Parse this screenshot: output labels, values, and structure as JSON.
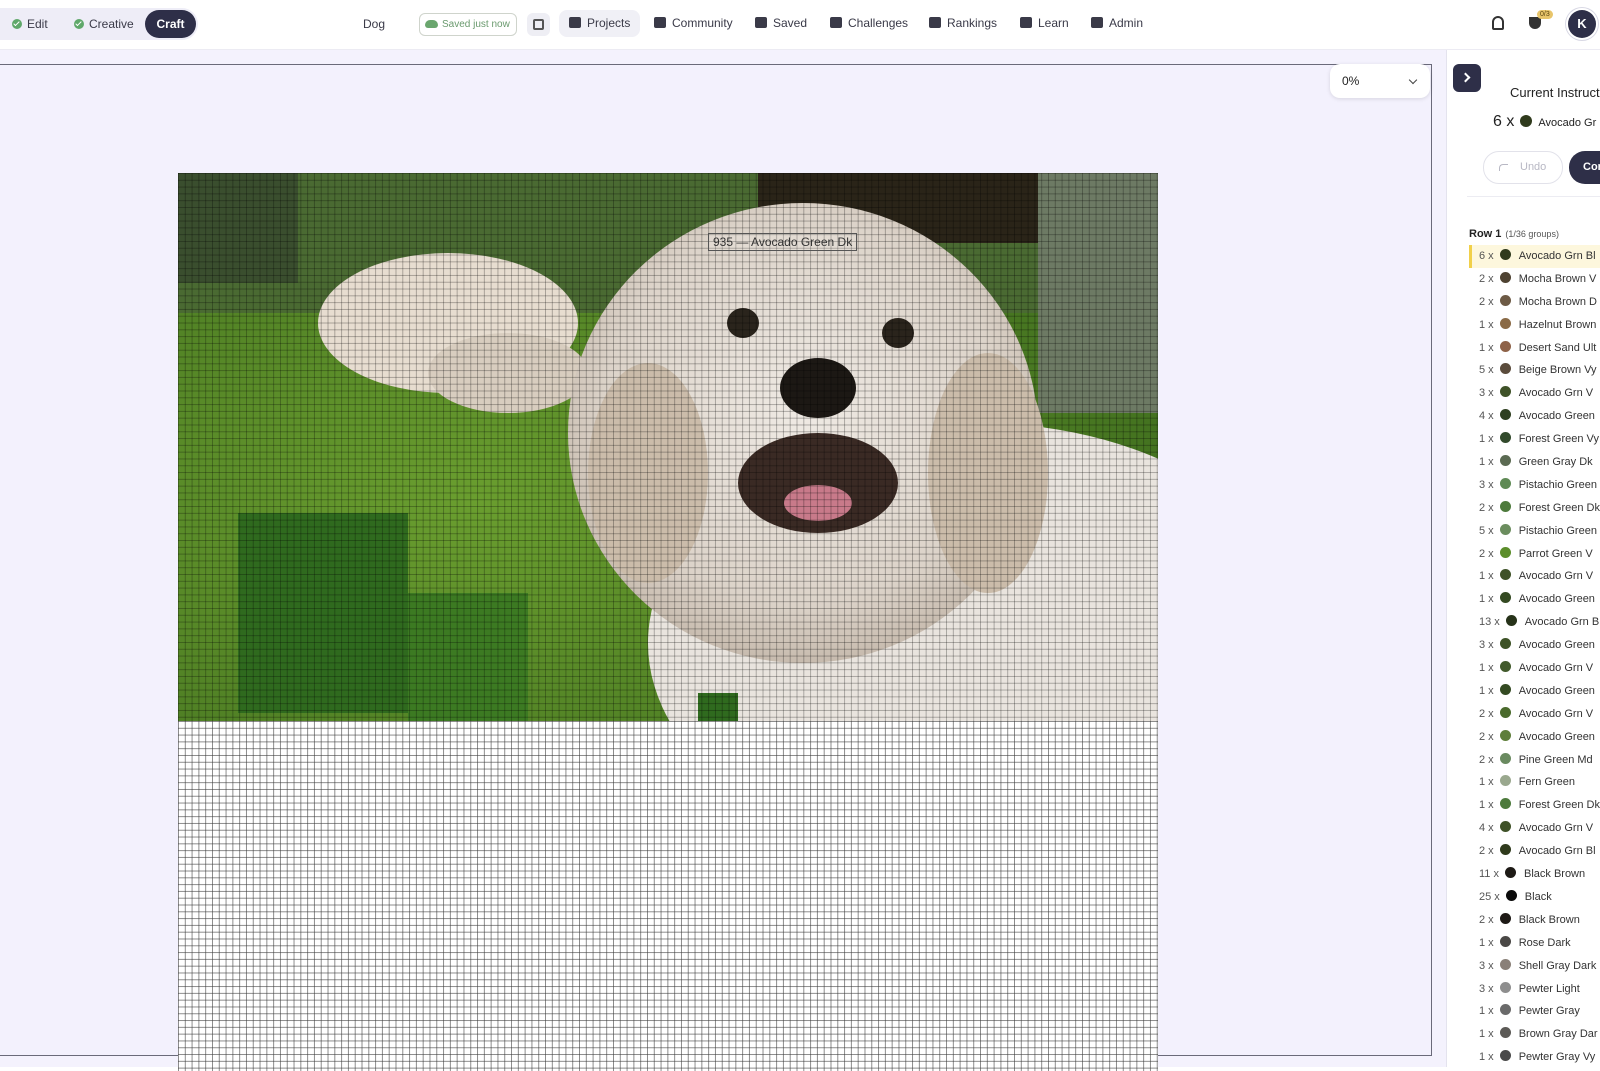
{
  "header": {
    "modes": [
      {
        "label": "Edit",
        "done": true
      },
      {
        "label": "Creative",
        "done": true
      },
      {
        "label": "Craft",
        "active": true
      }
    ],
    "project_name": "Dog",
    "saved_status": "Saved just now",
    "nav": [
      "Projects",
      "Community",
      "Saved",
      "Challenges",
      "Rankings",
      "Learn",
      "Admin"
    ],
    "active_nav": "Projects",
    "trophy_badge": "0/3",
    "avatar_initial": "K"
  },
  "canvas": {
    "zoom": "0%",
    "tooltip": "935 — Avocado Green Dk",
    "stitched_rows_fraction": 0.61
  },
  "panel": {
    "current_title": "Current Instruct",
    "current_count": "6 x",
    "current_color": "#2f3a1c",
    "current_name": "Avocado Gr",
    "undo_label": "Undo",
    "complete_label": "Cor",
    "row_label": "Row 1",
    "row_groups": "(1/36 groups)",
    "groups": [
      {
        "count": "6 x",
        "name": "Avocado Grn Bl",
        "color": "#2f3a1c",
        "active": true
      },
      {
        "count": "2 x",
        "name": "Mocha Brown V",
        "color": "#4e4231"
      },
      {
        "count": "2 x",
        "name": "Mocha Brown D",
        "color": "#6d5a45"
      },
      {
        "count": "1 x",
        "name": "Hazelnut Brown",
        "color": "#8a6a46"
      },
      {
        "count": "1 x",
        "name": "Desert Sand Ult",
        "color": "#8e6248"
      },
      {
        "count": "5 x",
        "name": "Beige Brown Vy",
        "color": "#5b4c3c"
      },
      {
        "count": "3 x",
        "name": "Avocado Grn V",
        "color": "#3f5228"
      },
      {
        "count": "4 x",
        "name": "Avocado Green",
        "color": "#2f4020"
      },
      {
        "count": "1 x",
        "name": "Forest Green Vy",
        "color": "#324a2c"
      },
      {
        "count": "1 x",
        "name": "Green Gray Dk",
        "color": "#5b6a52"
      },
      {
        "count": "3 x",
        "name": "Pistachio Green",
        "color": "#5f8a55"
      },
      {
        "count": "2 x",
        "name": "Forest Green Dk",
        "color": "#4d7a3c"
      },
      {
        "count": "5 x",
        "name": "Pistachio Green",
        "color": "#6b8d5e"
      },
      {
        "count": "2 x",
        "name": "Parrot Green V",
        "color": "#5b8d2a"
      },
      {
        "count": "1 x",
        "name": "Avocado Grn V",
        "color": "#3f5228"
      },
      {
        "count": "1 x",
        "name": "Avocado Green",
        "color": "#344a22"
      },
      {
        "count": "13 x",
        "name": "Avocado Grn B",
        "color": "#263219"
      },
      {
        "count": "3 x",
        "name": "Avocado Green",
        "color": "#3d5226"
      },
      {
        "count": "1 x",
        "name": "Avocado Grn V",
        "color": "#425a2c"
      },
      {
        "count": "1 x",
        "name": "Avocado Green",
        "color": "#344a22"
      },
      {
        "count": "2 x",
        "name": "Avocado Grn V",
        "color": "#4a6a2c"
      },
      {
        "count": "2 x",
        "name": "Avocado Green",
        "color": "#5e7e3a"
      },
      {
        "count": "2 x",
        "name": "Pine Green Md",
        "color": "#6a8a60"
      },
      {
        "count": "1 x",
        "name": "Fern Green",
        "color": "#9aa88e"
      },
      {
        "count": "1 x",
        "name": "Forest Green Dk",
        "color": "#4d7a3c"
      },
      {
        "count": "4 x",
        "name": "Avocado Grn V",
        "color": "#3f5228"
      },
      {
        "count": "2 x",
        "name": "Avocado Grn Bl",
        "color": "#2f3a1c"
      },
      {
        "count": "11 x",
        "name": "Black Brown",
        "color": "#1e1a16"
      },
      {
        "count": "25 x",
        "name": "Black",
        "color": "#0a0a0a"
      },
      {
        "count": "2 x",
        "name": "Black Brown",
        "color": "#1e1a16"
      },
      {
        "count": "1 x",
        "name": "Rose Dark",
        "color": "#4a4846"
      },
      {
        "count": "3 x",
        "name": "Shell Gray Dark",
        "color": "#8a8078"
      },
      {
        "count": "3 x",
        "name": "Pewter Light",
        "color": "#8e8e8e"
      },
      {
        "count": "1 x",
        "name": "Pewter Gray",
        "color": "#6a6a6a"
      },
      {
        "count": "1 x",
        "name": "Brown Gray Dar",
        "color": "#5c5a56"
      },
      {
        "count": "1 x",
        "name": "Pewter Gray Vy",
        "color": "#4a4a4a"
      }
    ]
  }
}
